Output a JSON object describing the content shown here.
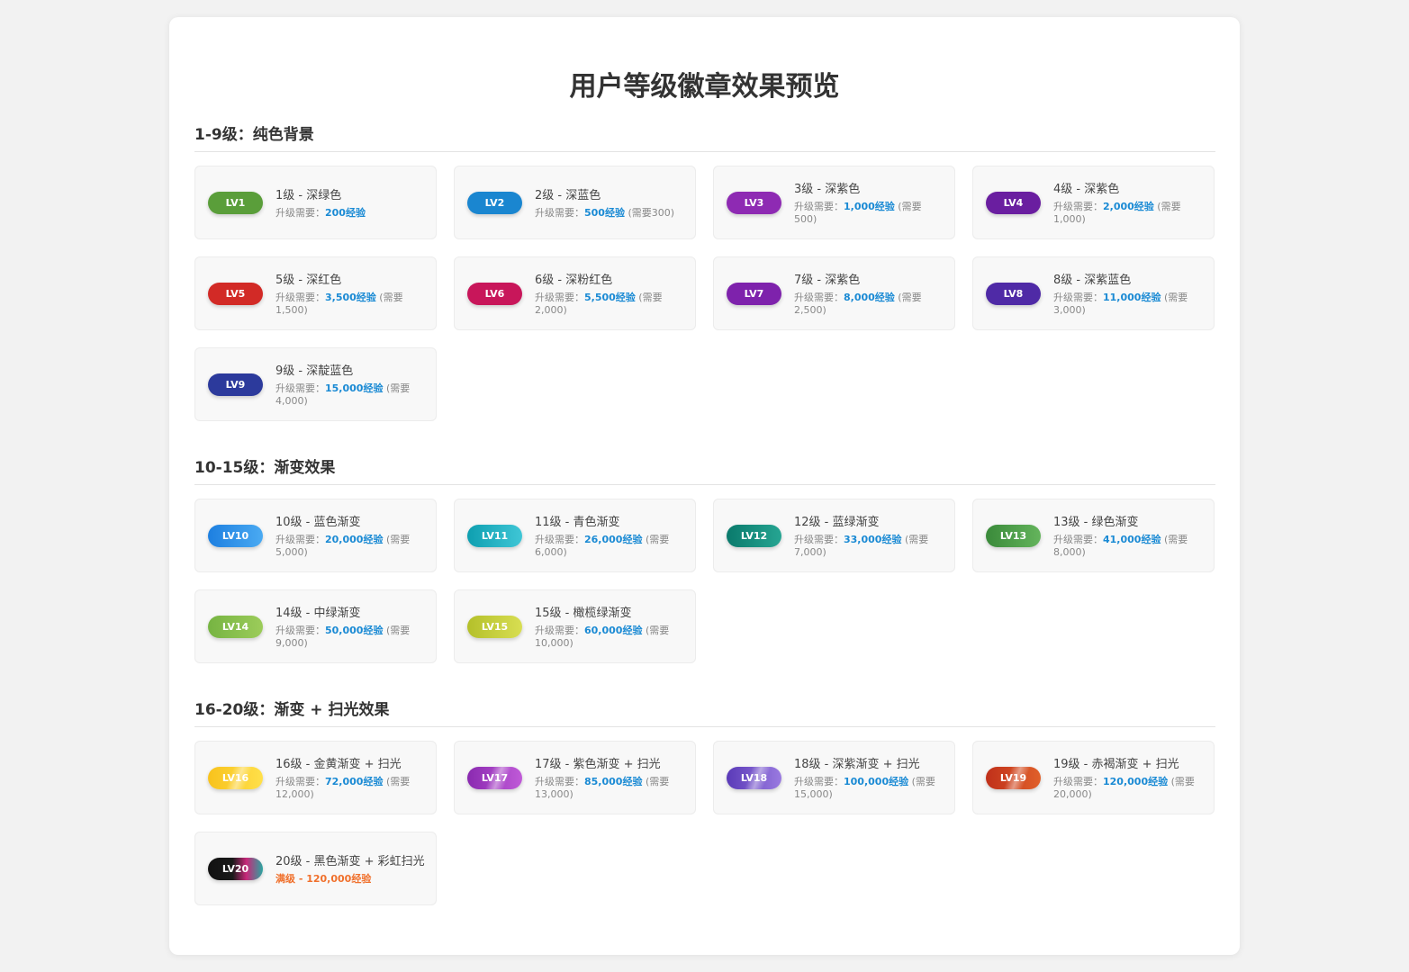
{
  "title": "用户等级徽章效果预览",
  "sections": [
    {
      "title": "1-9级：纯色背景",
      "items": [
        {
          "badge": "LV1",
          "title": "1级 - 深绿色",
          "req_label": "升级需要：",
          "exp": "200经验",
          "extra": "",
          "bg": "#5a9e3a",
          "shine": false
        },
        {
          "badge": "LV2",
          "title": "2级 - 深蓝色",
          "req_label": "升级需要：",
          "exp": "500经验",
          "extra": "(需要300)",
          "bg": "#1a86d0",
          "shine": false
        },
        {
          "badge": "LV3",
          "title": "3级 - 深紫色",
          "req_label": "升级需要：",
          "exp": "1,000经验",
          "extra": "(需要500)",
          "bg": "#8e2ab3",
          "shine": false
        },
        {
          "badge": "LV4",
          "title": "4级 - 深紫色",
          "req_label": "升级需要：",
          "exp": "2,000经验",
          "extra": "(需要1,000)",
          "bg": "#6a1ea0",
          "shine": false
        },
        {
          "badge": "LV5",
          "title": "5级 - 深红色",
          "req_label": "升级需要：",
          "exp": "3,500经验",
          "extra": "(需要1,500)",
          "bg": "#d22a26",
          "shine": false
        },
        {
          "badge": "LV6",
          "title": "6级 - 深粉红色",
          "req_label": "升级需要：",
          "exp": "5,500经验",
          "extra": "(需要2,000)",
          "bg": "#c8165a",
          "shine": false
        },
        {
          "badge": "LV7",
          "title": "7级 - 深紫色",
          "req_label": "升级需要：",
          "exp": "8,000经验",
          "extra": "(需要2,500)",
          "bg": "#7e22ac",
          "shine": false
        },
        {
          "badge": "LV8",
          "title": "8级 - 深紫蓝色",
          "req_label": "升级需要：",
          "exp": "11,000经验",
          "extra": "(需要3,000)",
          "bg": "#4f2aa6",
          "shine": false
        },
        {
          "badge": "LV9",
          "title": "9级 - 深靛蓝色",
          "req_label": "升级需要：",
          "exp": "15,000经验",
          "extra": "(需要4,000)",
          "bg": "#2c3a9c",
          "shine": false
        }
      ]
    },
    {
      "title": "10-15级：渐变效果",
      "items": [
        {
          "badge": "LV10",
          "title": "10级 - 蓝色渐变",
          "req_label": "升级需要：",
          "exp": "20,000经验",
          "extra": "(需要5,000)",
          "bg": "linear-gradient(90deg,#1d7fe0,#4aaaf2)",
          "shine": false
        },
        {
          "badge": "LV11",
          "title": "11级 - 青色渐变",
          "req_label": "升级需要：",
          "exp": "26,000经验",
          "extra": "(需要6,000)",
          "bg": "linear-gradient(90deg,#0e9fb0,#3fc6d6)",
          "shine": false
        },
        {
          "badge": "LV12",
          "title": "12级 - 蓝绿渐变",
          "req_label": "升级需要：",
          "exp": "33,000经验",
          "extra": "(需要7,000)",
          "bg": "linear-gradient(90deg,#0a7a6c,#26a592)",
          "shine": false
        },
        {
          "badge": "LV13",
          "title": "13级 - 绿色渐变",
          "req_label": "升级需要：",
          "exp": "41,000经验",
          "extra": "(需要8,000)",
          "bg": "linear-gradient(90deg,#3a8a3a,#64b45c)",
          "shine": false
        },
        {
          "badge": "LV14",
          "title": "14级 - 中绿渐变",
          "req_label": "升级需要：",
          "exp": "50,000经验",
          "extra": "(需要9,000)",
          "bg": "linear-gradient(90deg,#76b442,#9ccc5a)",
          "shine": false
        },
        {
          "badge": "LV15",
          "title": "15级 - 橄榄绿渐变",
          "req_label": "升级需要：",
          "exp": "60,000经验",
          "extra": "(需要10,000)",
          "bg": "linear-gradient(90deg,#b4c02a,#d8de52)",
          "shine": false
        }
      ]
    },
    {
      "title": "16-20级：渐变 + 扫光效果",
      "items": [
        {
          "badge": "LV16",
          "title": "16级 - 金黄渐变 + 扫光",
          "req_label": "升级需要：",
          "exp": "72,000经验",
          "extra": "(需要12,000)",
          "bg": "linear-gradient(90deg,#f8c21c,#ffe04a)",
          "shine": true
        },
        {
          "badge": "LV17",
          "title": "17级 - 紫色渐变 + 扫光",
          "req_label": "升级需要：",
          "exp": "85,000经验",
          "extra": "(需要13,000)",
          "bg": "linear-gradient(90deg,#8a2ab0,#c05ad8)",
          "shine": true
        },
        {
          "badge": "LV18",
          "title": "18级 - 深紫渐变 + 扫光",
          "req_label": "升级需要：",
          "exp": "100,000经验",
          "extra": "(需要15,000)",
          "bg": "linear-gradient(90deg,#5a3ab8,#9a7ae0)",
          "shine": true
        },
        {
          "badge": "LV19",
          "title": "19级 - 赤褐渐变 + 扫光",
          "req_label": "升级需要：",
          "exp": "120,000经验",
          "extra": "(需要20,000)",
          "bg": "linear-gradient(90deg,#c0301a,#e0602a)",
          "shine": true
        },
        {
          "badge": "LV20",
          "title": "20级 - 黑色渐变 + 彩虹扫光",
          "req_label": "",
          "exp": "",
          "extra": "",
          "max_text": "满级 - 120,000经验",
          "bg": "linear-gradient(90deg,#111111 0%,#1a1a1a 45%,#c8287a 70%,#2aa6a0 100%)",
          "shine": false
        }
      ]
    }
  ]
}
